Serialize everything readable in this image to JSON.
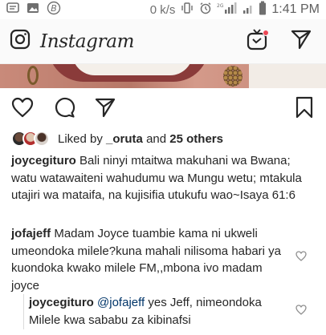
{
  "status_bar": {
    "network_speed": "0 k/s",
    "time": "1:41 PM"
  },
  "header": {
    "app_name": "Instagram"
  },
  "post": {
    "liked_by_prefix": "Liked by",
    "liked_by_user": "_oruta",
    "liked_by_and": "and",
    "liked_by_others": "25 others"
  },
  "comments": [
    {
      "username": "joycegituro",
      "text": " Bali ninyi mtaitwa makuhani wa Bwana; watu watawaiteni wahudumu wa Mungu wetu; mtakula utajiri wa mataifa, na kujisifia utukufu wao~Isaya 61:6"
    },
    {
      "username": "jofajeff",
      "text": " Madam Joyce tuambie kama ni ukweli umeondoka milele?kuna mahali nilisoma habari ya kuondoka kwako milele FM,,mbona ivo madam joyce"
    },
    {
      "username": "joycegituro",
      "mention": "@jofajeff",
      "text": " yes Jeff, nimeondoka Milele kwa sababu za kibinafsi"
    }
  ],
  "colors": {
    "text": "#262626",
    "mention": "#003569",
    "status_gray": "#6f6f6f",
    "notification_dot": "#ed4956"
  }
}
